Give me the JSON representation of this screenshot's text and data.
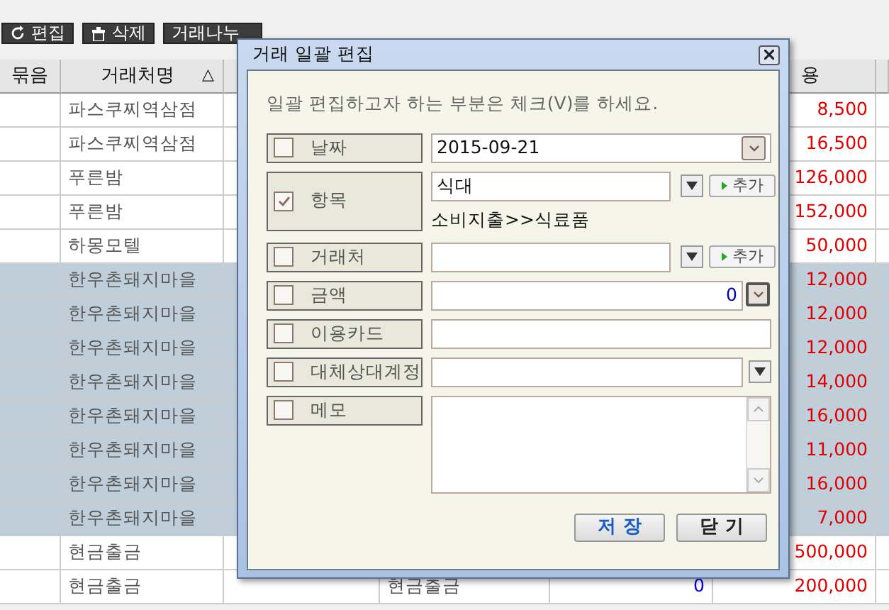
{
  "toolbar": [
    {
      "kind": "edit",
      "label": "편집"
    },
    {
      "kind": "delete",
      "label": "삭제"
    },
    {
      "kind": "plain",
      "label": "거래나누"
    }
  ],
  "table": {
    "columns": [
      {
        "label": "묶음"
      },
      {
        "label": "거래처명",
        "sort": "△"
      },
      {},
      {},
      {},
      {
        "label": "용"
      },
      {}
    ],
    "rows": [
      {
        "cells": [
          "",
          "파스쿠찌역삼점",
          "",
          "",
          "",
          "8,500",
          ""
        ],
        "selected": false
      },
      {
        "cells": [
          "",
          "파스쿠찌역삼점",
          "",
          "",
          "",
          "16,500",
          ""
        ],
        "selected": false
      },
      {
        "cells": [
          "",
          "푸른밤",
          "",
          "",
          "",
          "126,000",
          ""
        ],
        "selected": false
      },
      {
        "cells": [
          "",
          "푸른밤",
          "",
          "",
          "",
          "152,000",
          ""
        ],
        "selected": false
      },
      {
        "cells": [
          "",
          "하몽모텔",
          "",
          "",
          "",
          "50,000",
          ""
        ],
        "selected": false
      },
      {
        "cells": [
          "",
          "한우촌돼지마을",
          "",
          "",
          "",
          "12,000",
          ""
        ],
        "selected": true
      },
      {
        "cells": [
          "",
          "한우촌돼지마을",
          "",
          "",
          "",
          "12,000",
          ""
        ],
        "selected": true
      },
      {
        "cells": [
          "",
          "한우촌돼지마을",
          "",
          "",
          "",
          "12,000",
          ""
        ],
        "selected": true
      },
      {
        "cells": [
          "",
          "한우촌돼지마을",
          "",
          "",
          "",
          "14,000",
          ""
        ],
        "selected": true
      },
      {
        "cells": [
          "",
          "한우촌돼지마을",
          "",
          "",
          "",
          "16,000",
          ""
        ],
        "selected": true
      },
      {
        "cells": [
          "",
          "한우촌돼지마을",
          "",
          "",
          "",
          "11,000",
          ""
        ],
        "selected": true
      },
      {
        "cells": [
          "",
          "한우촌돼지마을",
          "",
          "",
          "",
          "16,000",
          ""
        ],
        "selected": true
      },
      {
        "cells": [
          "",
          "한우촌돼지마을",
          "",
          "",
          "",
          "7,000",
          ""
        ],
        "selected": true
      },
      {
        "cells": [
          "",
          "현금출금",
          "",
          "",
          "",
          "500,000",
          ""
        ],
        "selected": false
      },
      {
        "cells": [
          "",
          "현금출금",
          "",
          "현금출금",
          "0",
          "200,000",
          ""
        ],
        "selected": false
      }
    ]
  },
  "dialog": {
    "title": "거래 일괄 편집",
    "instruction": "일괄 편집하고자 하는 부분은 체크(V)를 하세요.",
    "fields": [
      {
        "kind": "date",
        "label": "날짜",
        "checked": false,
        "value": "2015-09-21"
      },
      {
        "kind": "combo_add",
        "label": "항목",
        "checked": true,
        "value": "식대",
        "add": "추가",
        "path": "소비지출>>식료품"
      },
      {
        "kind": "combo_add",
        "label": "거래처",
        "checked": false,
        "add": "추가"
      },
      {
        "kind": "amount",
        "label": "금액",
        "checked": false,
        "value": "0"
      },
      {
        "kind": "text",
        "label": "이용카드",
        "checked": false
      },
      {
        "kind": "combo",
        "label": "대체상대계정",
        "checked": false
      },
      {
        "kind": "memo",
        "label": "메모",
        "checked": false
      }
    ],
    "buttons": [
      {
        "kind": "save",
        "label": "저 장"
      },
      {
        "kind": "close",
        "label": "닫 기"
      }
    ]
  }
}
